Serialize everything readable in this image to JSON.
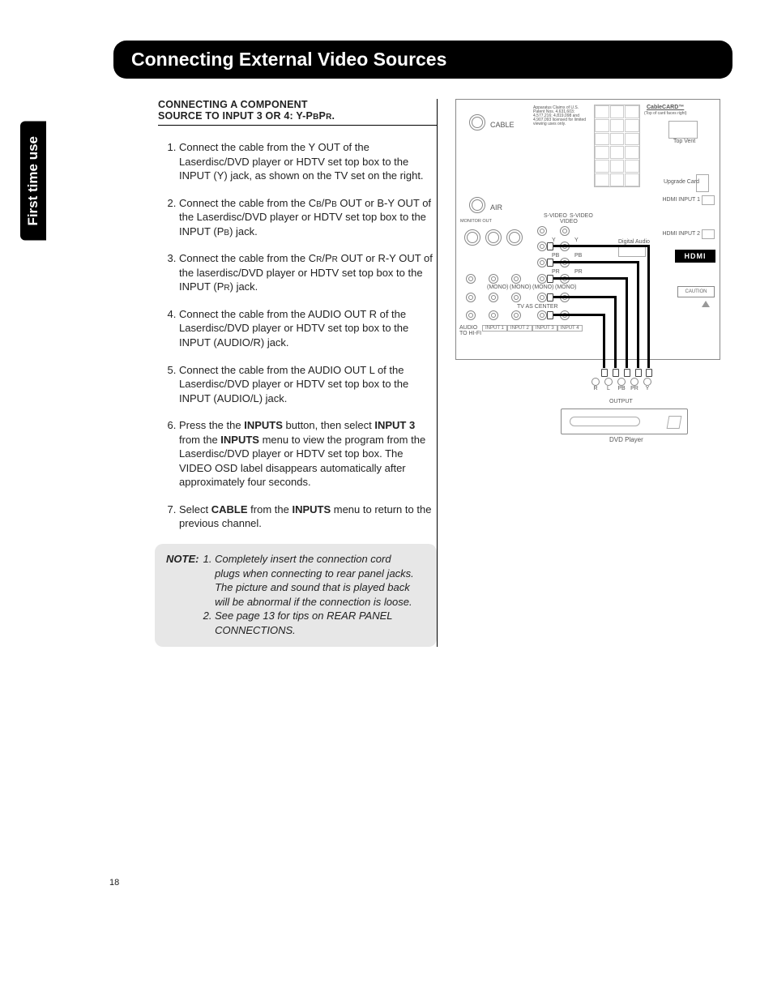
{
  "page_number": "18",
  "side_tab": "First time use",
  "title": "Connecting External Video Sources",
  "sub_head_line1": "CONNECTING A COMPONENT",
  "sub_head_line2a": "SOURCE TO INPUT 3 OR 4: Y-P",
  "sub_head_line2b": "B",
  "sub_head_line2c": "P",
  "sub_head_line2d": "R",
  "sub_head_line2e": ".",
  "steps": {
    "1": "Connect the cable from the Y OUT of the Laserdisc/DVD player or HDTV set top box to the INPUT (Y) jack, as shown on the TV set on the right.",
    "2a": "Connect the cable from the C",
    "2b": "B",
    "2c": "/P",
    "2d": "B",
    "2e": " OUT or B-Y OUT of the Laserdisc/DVD player or HDTV set top box to the INPUT (P",
    "2f": "B",
    "2g": ") jack.",
    "3a": "Connect the cable from the C",
    "3b": "R",
    "3c": "/P",
    "3d": "R",
    "3e": " OUT or R-Y OUT of the laserdisc/DVD player or HDTV set top box to the INPUT (P",
    "3f": "R",
    "3g": ") jack.",
    "4": "Connect the cable from the AUDIO OUT R of the Laserdisc/DVD player or HDTV set top box to the INPUT (AUDIO/R) jack.",
    "5": "Connect the cable from the AUDIO OUT L of the Laserdisc/DVD player or HDTV set top box to the INPUT (AUDIO/L) jack.",
    "6a": "Press the the ",
    "6b": "INPUTS",
    "6c": " button, then select ",
    "6d": "INPUT 3",
    "6e": " from the ",
    "6f": "INPUTS",
    "6g": " menu to view the program from the Laserdisc/DVD player or HDTV set top box. The VIDEO OSD label disappears automatically after approximately four seconds.",
    "7a": "Select ",
    "7b": "CABLE",
    "7c": " from the ",
    "7d": "INPUTS",
    "7e": " menu to return to the previous channel."
  },
  "note_label": "NOTE:",
  "notes": {
    "1": "Completely insert the connection cord plugs when connecting to rear panel jacks. The picture and sound that is played back will be abnormal if the connection is loose.",
    "2": "See page 13 for tips on REAR PANEL CONNECTIONS."
  },
  "diagram": {
    "cable": "CABLE",
    "air": "AIR",
    "cablecard": "CableCARD™",
    "cablecard_sub": "(Top of card faces right)",
    "patent": "Apparatus Claims of U.S. Patent Nos. 4,631,603; 4,577,216; 4,819,098 and 4,907,093 licensed for limited viewing uses only.",
    "top_vent": "Top Vent",
    "upgrade": "Upgrade Card",
    "hdmi1": "HDMI INPUT 1",
    "hdmi2": "HDMI INPUT 2",
    "hdmi_logo": "HDMI",
    "digital_audio": "Digital Audio",
    "caution": "CAUTION",
    "monitor_out": "MONITOR OUT",
    "svideo": "S-VIDEO",
    "video": "VIDEO",
    "pb": "PB",
    "pr": "PR",
    "y": "Y",
    "mono": "(MONO)",
    "tv_center": "TV AS CENTER",
    "audio_hifi": "AUDIO TO HI-FI",
    "input1": "INPUT 1",
    "input2": "INPUT 2",
    "input3": "INPUT 3",
    "input4": "INPUT 4",
    "output": "OUTPUT",
    "out_r": "R",
    "out_l": "L",
    "out_pb": "PB",
    "out_pr": "PR",
    "out_y": "Y",
    "dvd": "DVD Player"
  }
}
